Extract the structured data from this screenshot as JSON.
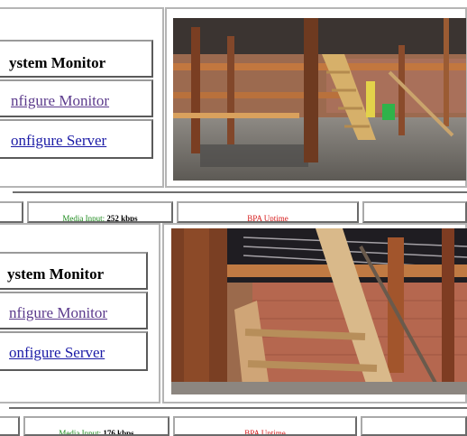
{
  "top": {
    "menu": {
      "title": "ystem Monitor",
      "items": [
        "nfigure Monitor",
        "onfigure Server"
      ]
    },
    "stats": {
      "media_label": "Media Input:",
      "media_value": "252 kbps",
      "uptime_label": "BPA Uptime"
    }
  },
  "bottom": {
    "menu": {
      "title": "ystem Monitor",
      "items": [
        "nfigure Monitor",
        "onfigure Server"
      ]
    },
    "stats": {
      "media_label": "Media Input:",
      "media_value": "176 kbps",
      "uptime_label": "BPA Uptime"
    }
  },
  "colors": {
    "link_visited": "#5b3a8c",
    "link": "#1a1aa6",
    "media_label": "#1c8a1c",
    "uptime_label": "#d61a1a"
  },
  "images": [
    "construction-site-video-feed",
    "construction-site-video-feed-closeup"
  ]
}
